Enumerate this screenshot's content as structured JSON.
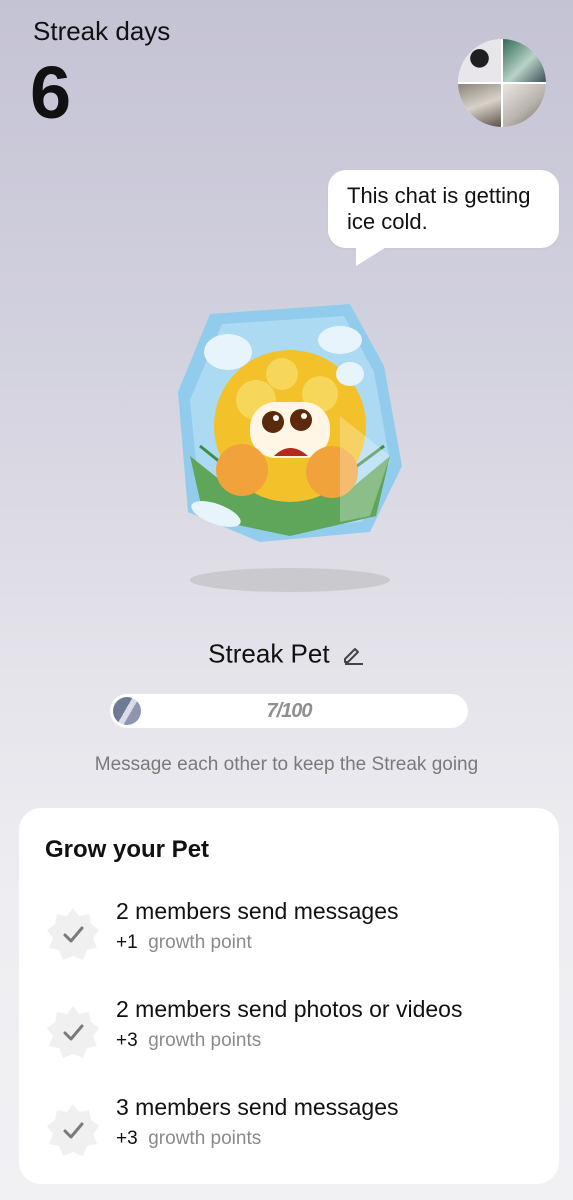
{
  "header": {
    "title": "Streak days",
    "count": "6"
  },
  "speech_bubble": {
    "text": "This chat is getting ice cold."
  },
  "pet": {
    "name": "Streak Pet"
  },
  "progress": {
    "label": "7/100",
    "value": 7,
    "max": 100
  },
  "hint": "Message each other to keep the Streak going",
  "grow_card": {
    "title": "Grow your Pet",
    "tasks": [
      {
        "title": "2 members send messages",
        "points": "+1",
        "unit": "growth point"
      },
      {
        "title": "2 members send photos or videos",
        "points": "+3",
        "unit": "growth points"
      },
      {
        "title": "3 members send messages",
        "points": "+3",
        "unit": "growth points"
      }
    ]
  },
  "colors": {
    "card_bg": "#ffffff",
    "hint_text": "#7a7a7a",
    "badge_bg": "#f0f0f0",
    "check": "#7a7a7a"
  }
}
